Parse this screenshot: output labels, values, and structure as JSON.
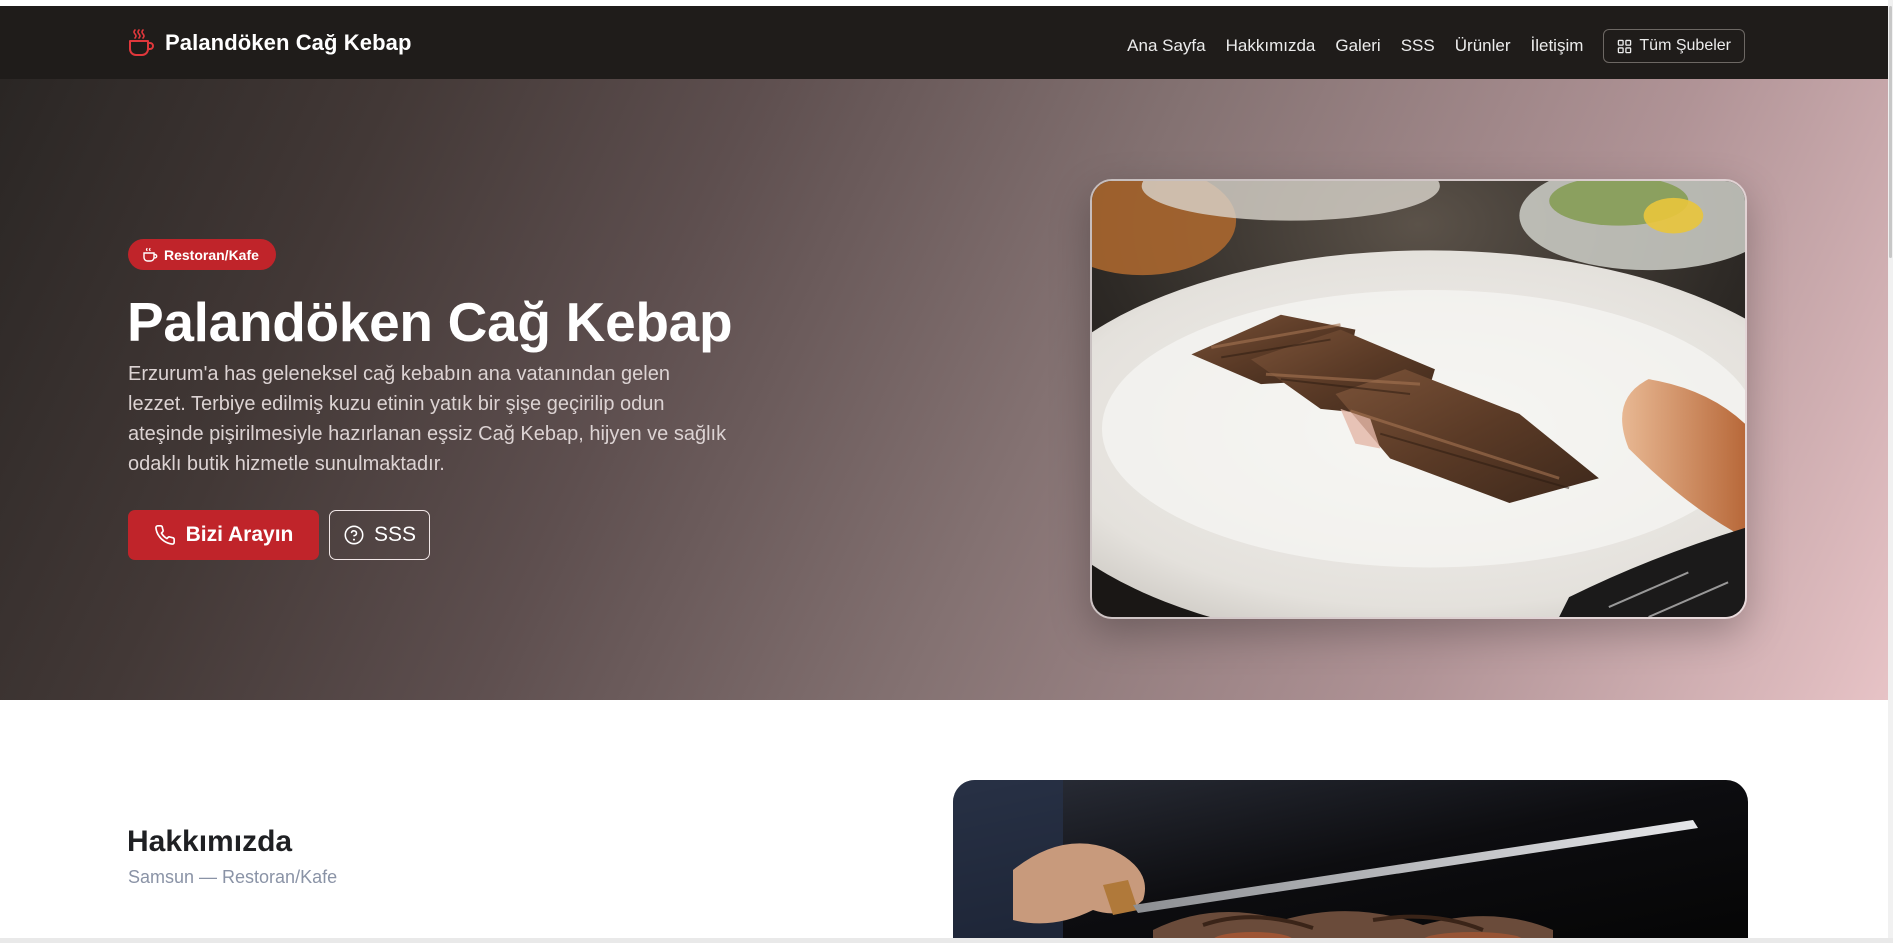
{
  "brand": {
    "name": "Palandöken Cağ Kebap",
    "icon": "steaming-cup-icon"
  },
  "nav": {
    "items": [
      "Ana Sayfa",
      "Hakkımızda",
      "Galeri",
      "SSS",
      "Ürünler",
      "İletişim"
    ],
    "branches_label": "Tüm Şubeler"
  },
  "hero": {
    "badge": "Restoran/Kafe",
    "title": "Palandöken Cağ Kebap",
    "description": "Erzurum'a has geleneksel cağ kebabın ana vatanından gelen lezzet. Terbiye edilmiş kuzu etinin yatık bir şişe geçirilip odun ateşinde pişirilmesiyle hazırlanan eşsiz Cağ Kebap, hijyen ve sağlık odaklı butik hizmetle sunulmaktadır.",
    "call_button": "Bizi Arayın",
    "faq_button": "SSS"
  },
  "about": {
    "title": "Hakkımızda",
    "subtitle": "Samsun — Restoran/Kafe"
  },
  "colors": {
    "accent": "#c0242a",
    "navbar": "#1f1c1a"
  }
}
